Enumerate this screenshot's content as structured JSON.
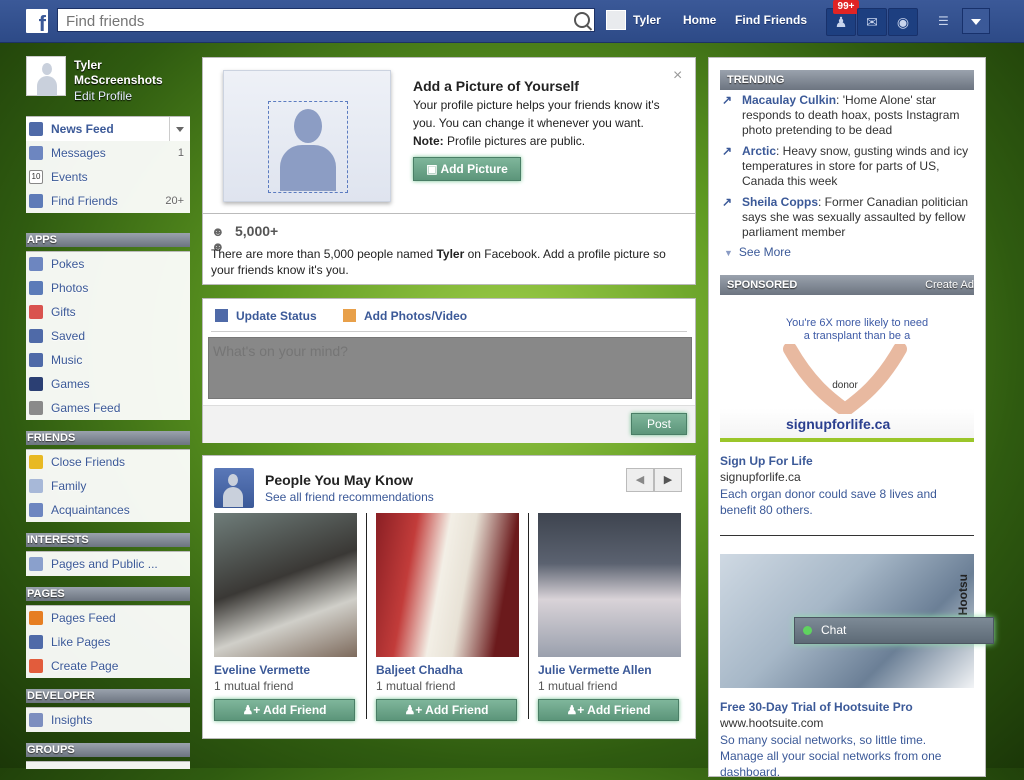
{
  "topbar": {
    "logo": "f",
    "search_placeholder": "Find friends",
    "user_name": "Tyler",
    "nav_home": "Home",
    "nav_find_friends": "Find Friends",
    "notif_badge": "99+"
  },
  "profile": {
    "name": "Tyler McScreenshots",
    "edit": "Edit Profile"
  },
  "sidebar": {
    "favorites": [
      {
        "label": "News Feed",
        "count": ""
      },
      {
        "label": "Messages",
        "count": "1"
      },
      {
        "label": "Events",
        "count": ""
      },
      {
        "label": "Find Friends",
        "count": "20+"
      }
    ],
    "apps_header": "APPS",
    "apps": [
      "Pokes",
      "Photos",
      "Gifts",
      "Saved",
      "Music",
      "Games",
      "Games Feed"
    ],
    "friends_header": "FRIENDS",
    "friends": [
      "Close Friends",
      "Family",
      "Acquaintances"
    ],
    "interests_header": "INTERESTS",
    "interests": [
      "Pages and Public ..."
    ],
    "pages_header": "PAGES",
    "pages": [
      "Pages Feed",
      "Like Pages",
      "Create Page"
    ],
    "developer_header": "DEVELOPER",
    "developer": [
      "Insights"
    ],
    "groups_header": "GROUPS"
  },
  "add_picture": {
    "title": "Add a Picture of Yourself",
    "body": "Your profile picture helps your friends know it's you. You can change it whenever you want.",
    "note_label": "Note:",
    "note_text": "Profile pictures are public.",
    "button": "Add Picture",
    "close": "×",
    "people_count": "5,000+",
    "people_text_1": "There are more than 5,000 people named ",
    "people_name": "Tyler",
    "people_text_2": " on Facebook. Add a profile picture so your friends know it's you."
  },
  "status": {
    "tab_update": "Update Status",
    "tab_photos": "Add Photos/Video",
    "placeholder": "What's on your mind?",
    "post": "Post"
  },
  "pymk": {
    "title": "People You May Know",
    "link": "See all friend recommendations",
    "people": [
      {
        "name": "Eveline Vermette",
        "mutual": "1 mutual friend",
        "button": "Add Friend"
      },
      {
        "name": "Baljeet Chadha",
        "mutual": "1 mutual friend",
        "button": "Add Friend"
      },
      {
        "name": "Julie Vermette Allen",
        "mutual": "1 mutual friend",
        "button": "Add Friend"
      }
    ]
  },
  "trending": {
    "header": "TRENDING",
    "items": [
      {
        "topic": "Macaulay Culkin",
        "text": ": 'Home Alone' star responds to death hoax, posts Instagram photo pretending to be dead"
      },
      {
        "topic": "Arctic",
        "text": ": Heavy snow, gusting winds and icy temperatures in store for parts of US, Canada this week"
      },
      {
        "topic": "Sheila Copps",
        "text": ": Former Canadian politician says she was sexually assaulted by fellow parliament member"
      }
    ],
    "see_more": "See More"
  },
  "sponsored": {
    "header": "SPONSORED",
    "create_ad": "Create Ad",
    "ad1": {
      "headline": "You're 6X more likely to need a transplant than be a",
      "heart_text": "donor",
      "logo": "signupforlife.ca",
      "title": "Sign Up For Life",
      "url": "signupforlife.ca",
      "desc": "Each organ donor could save 8 lives and benefit 80 others."
    },
    "ad2": {
      "brand": "Hootsu",
      "title": "Free 30-Day Trial of Hootsuite Pro",
      "url": "www.hootsuite.com",
      "desc": "So many social networks, so little time. Manage all your social networks from one dashboard."
    }
  },
  "chat": {
    "label": "Chat"
  },
  "colors": {
    "brand": "#3b5998",
    "action_green": "#5c957a",
    "badge_red": "#e02424"
  }
}
